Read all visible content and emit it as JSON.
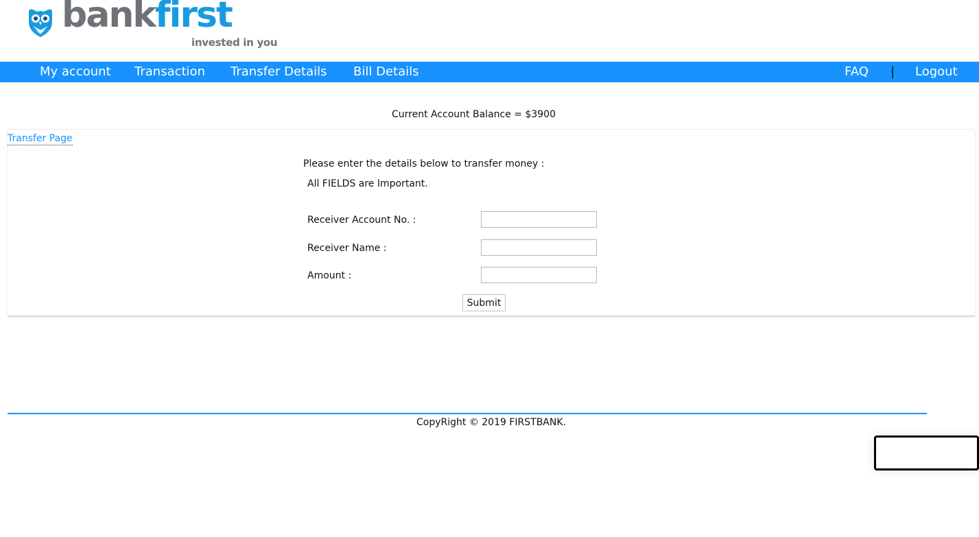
{
  "brand": {
    "name_part1": "bank",
    "name_part2": "first",
    "tagline": "invested in you",
    "colors": {
      "gray": "#6f7378",
      "blue": "#1a9be0"
    },
    "icon": "owl-logo-icon"
  },
  "nav": {
    "background": "#1792fe",
    "items": [
      {
        "label": "My account"
      },
      {
        "label": "Transaction"
      },
      {
        "label": "Transfer Details"
      },
      {
        "label": "Bill Details"
      }
    ],
    "right_items": [
      {
        "label": "FAQ"
      },
      {
        "label": "Logout"
      }
    ],
    "separator": "|"
  },
  "balance": {
    "text": "Current Account Balance = $3900"
  },
  "transfer": {
    "page_link": "Transfer Page",
    "instruction": "Please enter the details below to transfer money :",
    "note": "All FIELDS are Important.",
    "fields": [
      {
        "label": "Receiver Account No. :",
        "value": ""
      },
      {
        "label": "Receiver Name :",
        "value": ""
      },
      {
        "label": "Amount :",
        "value": ""
      }
    ],
    "submit_label": "Submit"
  },
  "footer": {
    "copyright": "CopyRight © 2019 FIRSTBANK."
  }
}
